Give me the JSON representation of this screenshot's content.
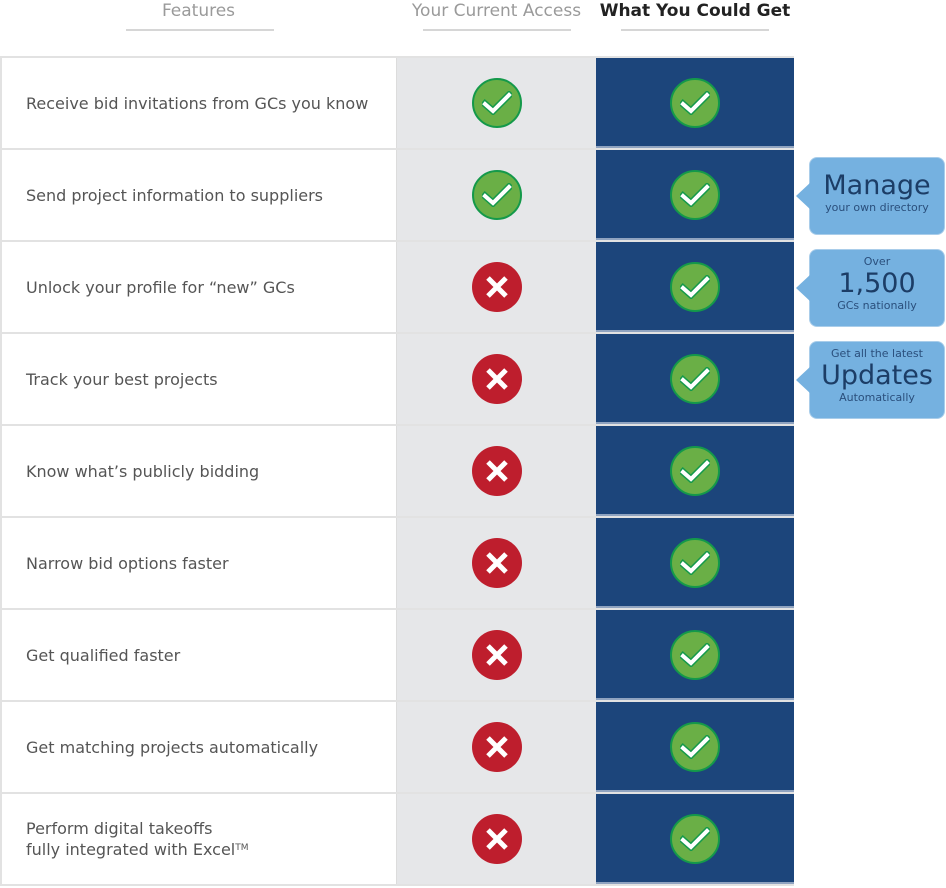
{
  "header": {
    "features": "Features",
    "current_access": "Your Current Access",
    "could_get": "What You Could Get"
  },
  "colors": {
    "current_col_bg": "#e6e7e9",
    "could_get_col_bg": "#1c457b",
    "check_green": "#6aaf46",
    "cross_red": "#be1e2d",
    "callout_blue": "#75b1e0"
  },
  "rows": [
    {
      "lines": [
        "Receive bid invitations from GCs you know"
      ],
      "current": "check",
      "could_get": "check"
    },
    {
      "lines": [
        "Send project information to suppliers"
      ],
      "current": "check",
      "could_get": "check"
    },
    {
      "lines": [
        "Unlock your profile for “new” GCs"
      ],
      "current": "cross",
      "could_get": "check"
    },
    {
      "lines": [
        "Track your best projects"
      ],
      "current": "cross",
      "could_get": "check"
    },
    {
      "lines": [
        "Know what’s publicly bidding"
      ],
      "current": "cross",
      "could_get": "check"
    },
    {
      "lines": [
        "Narrow bid options faster"
      ],
      "current": "cross",
      "could_get": "check"
    },
    {
      "lines": [
        "Get qualified faster"
      ],
      "current": "cross",
      "could_get": "check"
    },
    {
      "lines": [
        "Get matching projects automatically"
      ],
      "current": "cross",
      "could_get": "check"
    },
    {
      "lines": [
        "Perform digital takeoffs",
        "fully integrated with Excel"
      ],
      "trademark": "TM",
      "current": "cross",
      "could_get": "check"
    }
  ],
  "callouts": [
    {
      "top": "",
      "big": "Manage",
      "bottom": "your own directory"
    },
    {
      "top": "Over",
      "big": "1,500",
      "bottom": "GCs nationally"
    },
    {
      "top": "Get all the latest",
      "big": "Updates",
      "bottom": "Automatically"
    }
  ]
}
